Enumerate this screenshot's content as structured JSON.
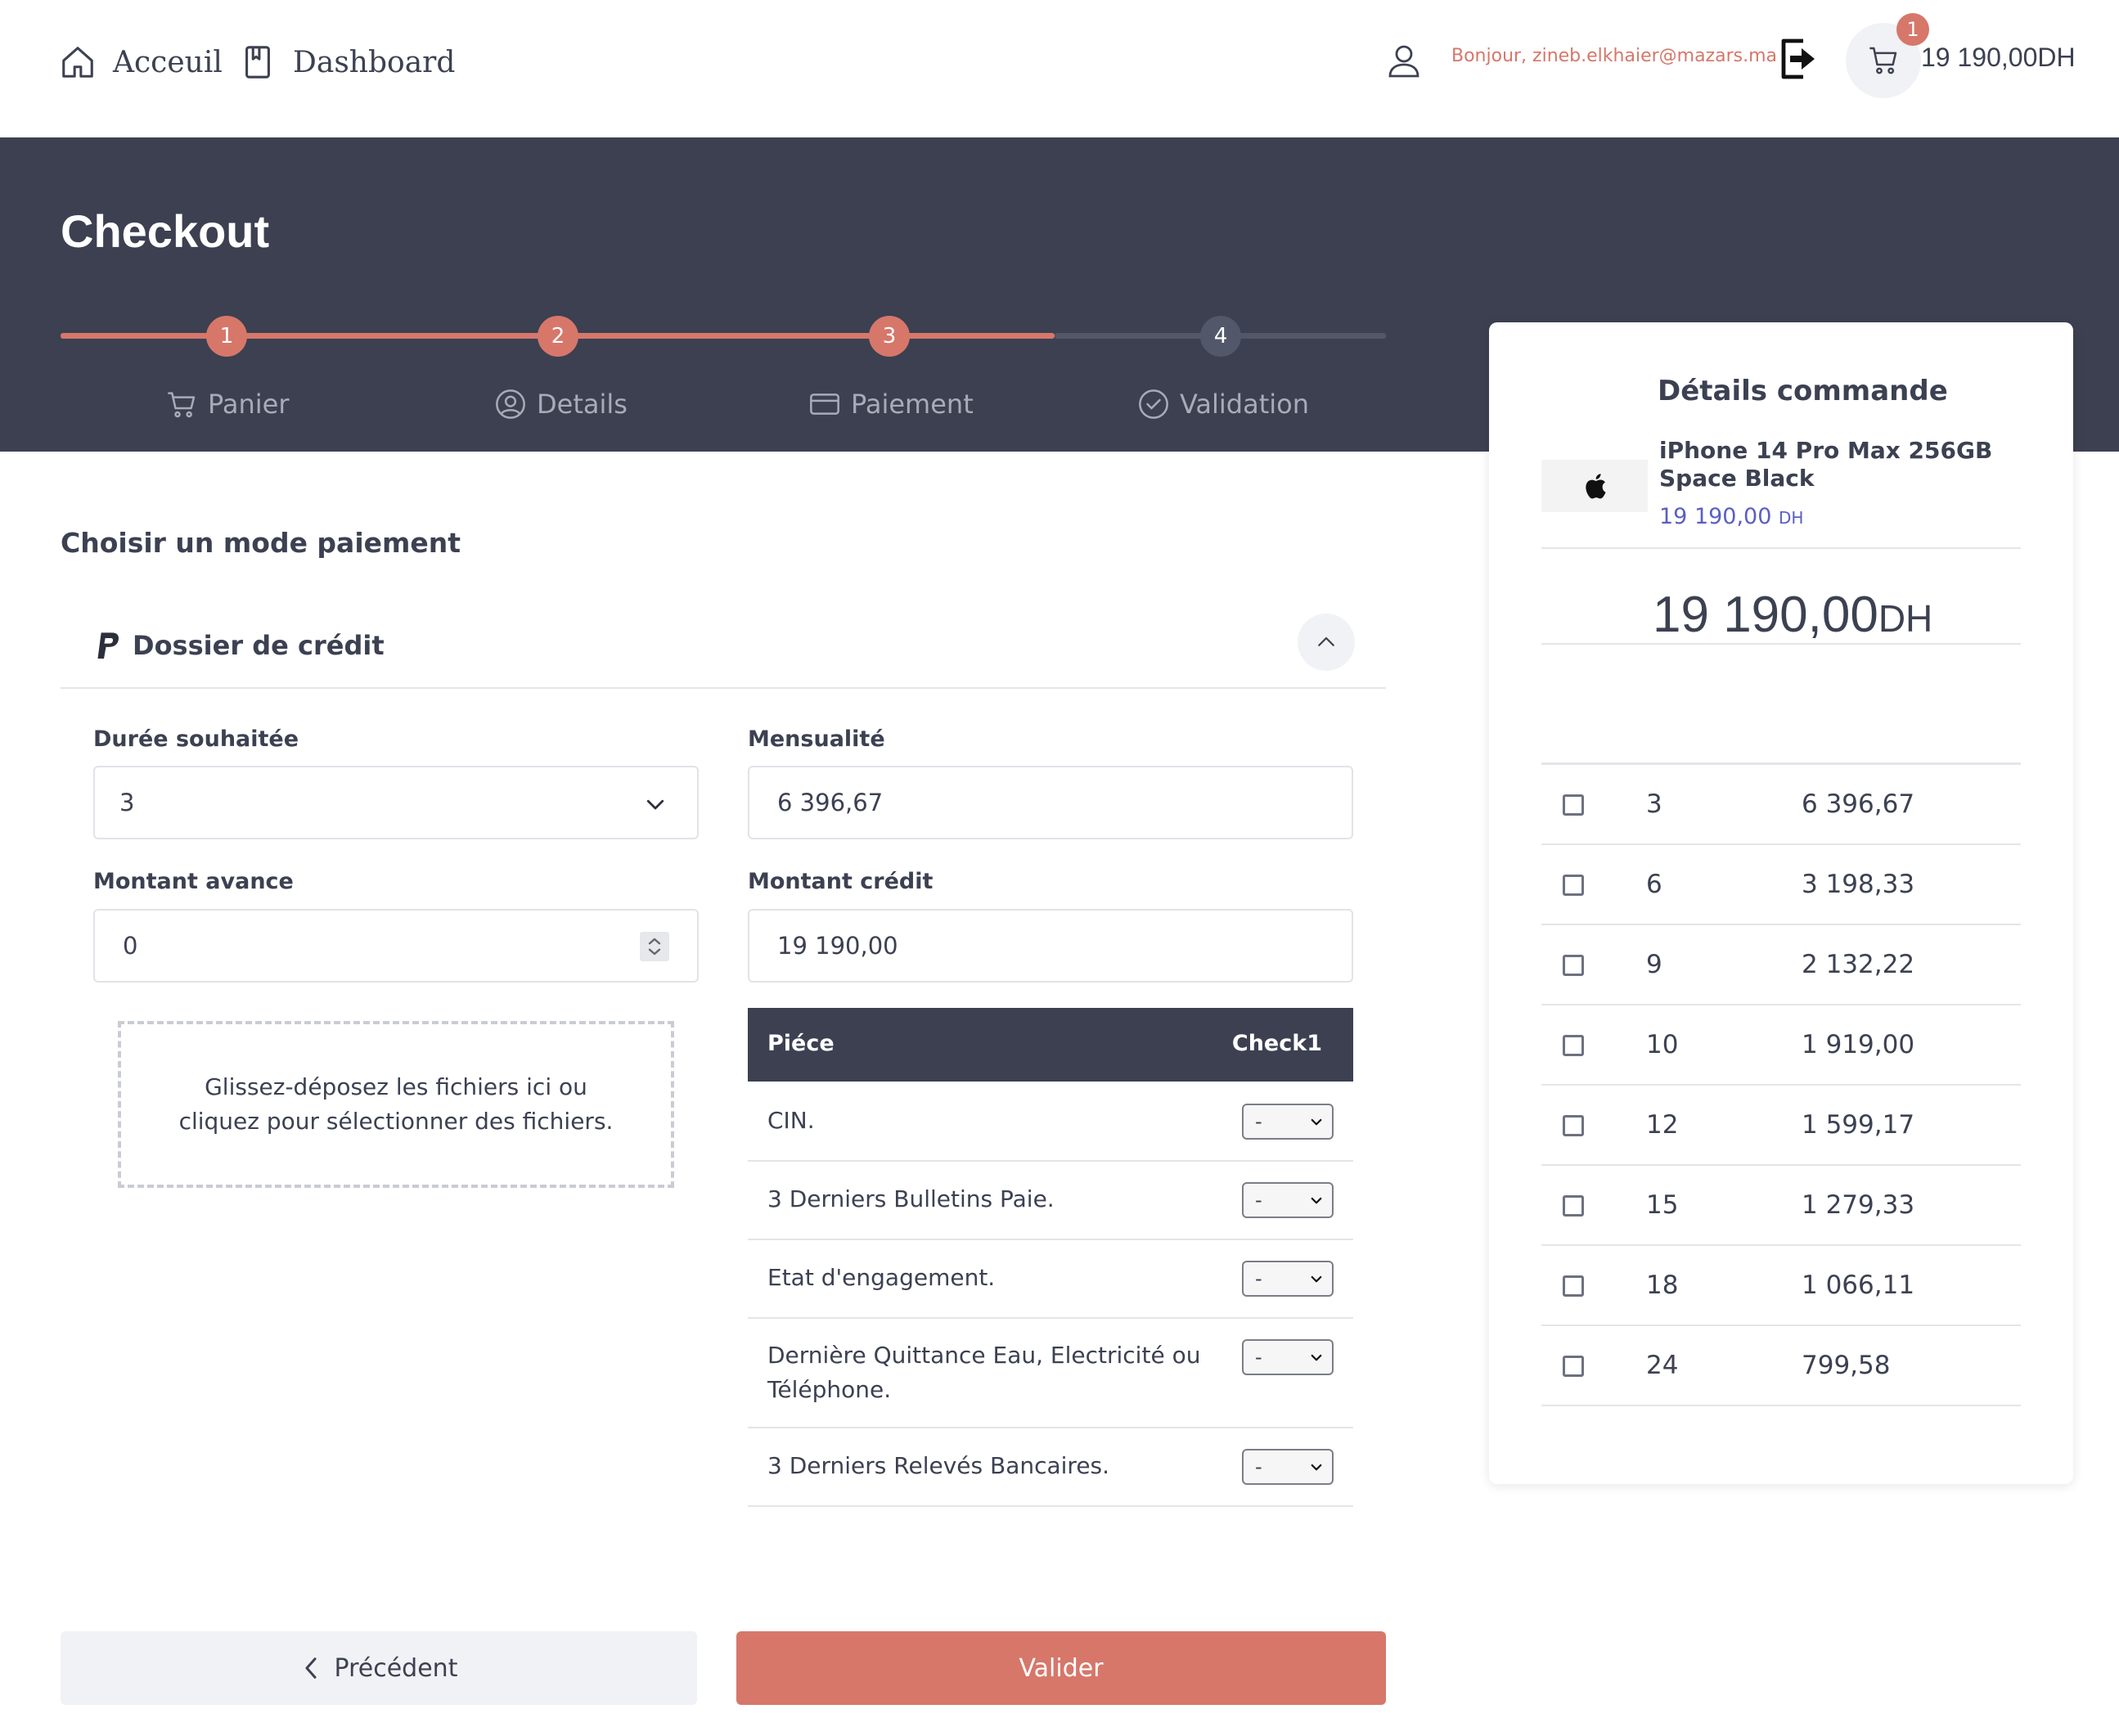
{
  "nav": {
    "home_label": "Acceuil",
    "dashboard_label": "Dashboard",
    "greeting": "Bonjour, zineb.elkhaier@mazars.ma",
    "cart_count": "1",
    "cart_total": "19 190,00DH"
  },
  "header": {
    "title": "Checkout",
    "steps": [
      {
        "number": "1",
        "label": "Panier",
        "icon": "cart-icon",
        "completed": true
      },
      {
        "number": "2",
        "label": "Details",
        "icon": "user-circle-icon",
        "completed": true
      },
      {
        "number": "3",
        "label": "Paiement",
        "icon": "credit-card-icon",
        "completed": true
      },
      {
        "number": "4",
        "label": "Validation",
        "icon": "check-circle-icon",
        "completed": false
      }
    ]
  },
  "payment": {
    "section_title": "Choisir un mode paiement",
    "method_title": "Dossier de crédit",
    "method_icon": "paypal-icon",
    "duree_label": "Durée souhaitée",
    "duree_value": "3",
    "mensualite_label": "Mensualité",
    "mensualite_value": "6 396,67",
    "avance_label": "Montant avance",
    "avance_value": "0",
    "credit_label": "Montant crédit",
    "credit_value": "19 190,00",
    "dropzone_text": "Glissez-déposez les fichiers ici ou cliquez pour sélectionner des fichiers.",
    "pieces_header": {
      "piece": "Piéce",
      "check": "Check1"
    },
    "pieces": [
      {
        "label": "CIN.",
        "value": "-"
      },
      {
        "label": "3 Derniers Bulletins Paie.",
        "value": "-"
      },
      {
        "label": "Etat d'engagement.",
        "value": "-"
      },
      {
        "label": "Dernière Quittance Eau, Electricité ou Téléphone.",
        "value": "-"
      },
      {
        "label": "3 Derniers Relevés Bancaires.",
        "value": "-"
      }
    ]
  },
  "buttons": {
    "prev_label": "Précédent",
    "submit_label": "Valider"
  },
  "order": {
    "title": "Détails commande",
    "product_name": "iPhone 14 Pro Max 256GB Space Black",
    "product_price": "19 190,00",
    "product_currency": "DH",
    "total_amount": "19 190,00",
    "total_currency": "DH",
    "plans": [
      {
        "months": "3",
        "amount": "6 396,67"
      },
      {
        "months": "6",
        "amount": "3 198,33"
      },
      {
        "months": "9",
        "amount": "2 132,22"
      },
      {
        "months": "10",
        "amount": "1 919,00"
      },
      {
        "months": "12",
        "amount": "1 599,17"
      },
      {
        "months": "15",
        "amount": "1 279,33"
      },
      {
        "months": "18",
        "amount": "1 066,11"
      },
      {
        "months": "24",
        "amount": "799,58"
      }
    ]
  },
  "colors": {
    "accent": "#d6776a",
    "header_bg": "#3c4051",
    "price_blue": "#5a5fc4"
  }
}
